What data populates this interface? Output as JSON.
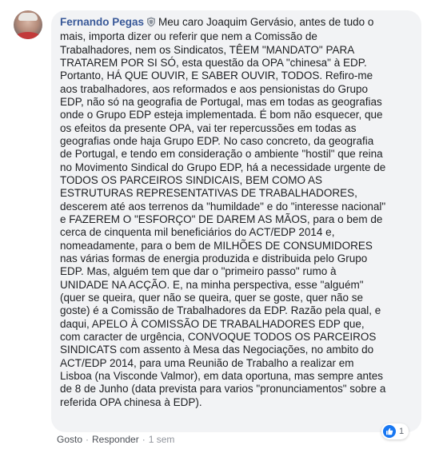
{
  "comment": {
    "author": "Fernando Pegas",
    "body": "Meu caro Joaquim Gervásio, antes de tudo o\nmais, importa dizer ou referir que nem a Comissão de\nTrabalhadores, nem os Sindicatos, TÊEM \"MANDATO\" PARA\nTRATAREM POR SI SÓ, esta questão da OPA \"chinesa\" à EDP.\nPortanto, HÁ QUE OUVIR, E SABER OUVIR, TODOS. Refiro-me\naos trabalhadores, aos reformados e aos pensionistas do Grupo\nEDP, não só na geografia de Portugal, mas em todas as geografias\nonde o Grupo EDP esteja implementada. É bom não esquecer, que\nos efeitos da presente OPA, vai ter repercussões em todas as\ngeografias onde haja Grupo EDP. No caso concreto, da geografia\nde Portugal, e tendo em consideração o ambiente \"hostil\" que reina\nno Movimento Sindical do Grupo EDP, há a necessidade urgente de\nTODOS OS PARCEIROS SINDICAIS, BEM COMO AS\nESTRUTURAS REPRESENTATIVAS DE TRABALHADORES,\ndescerem até aos terrenos da \"humildade\" e do \"interesse nacional\"\ne FAZEREM O \"ESFORÇO\" DE DAREM AS MÃOS, para o bem de\ncerca de cinquenta mil beneficiários do ACT/EDP 2014 e,\nnomeadamente, para o bem de MILHÕES DE CONSUMIDORES\nnas várias formas de energia produzida e distribuida pelo Grupo\nEDP. Mas, alguém tem que dar o \"primeiro passo\" rumo à\nUNIDADE NA ACÇÃO. E, na minha perspectiva, esse \"alguém\"\n(quer se queira, quer não se queira, quer se goste, quer não se\ngoste) é a Comissão de Trabalhadores da EDP. Razão pela qual, e\ndaqui, APELO À COMISSÃO DE TRABALHADORES EDP que,\ncom caracter de urgência, CONVOQUE TODOS OS PARCEIROS\nSINDICATS com assento à Mesa das Negociações, no ambito do\nACT/EDP 2014, para uma Reunião de Trabalho a realizar em\nLisboa (na Visconde Valmor), em data oportuna, mas sempre antes\nde 8 de Junho (data prevista para varios \"pronunciamentos\" sobre a\nreferida OPA chinesa à EDP).",
    "badge_icon": "shield-icon",
    "colors": {
      "author": "#385898",
      "bubble": "#f2f3f5",
      "like": "#1877f2"
    }
  },
  "actions": {
    "like_label": "Gosto",
    "separator": "·",
    "reply_label": "Responder",
    "time": "1 sem"
  },
  "reactions": {
    "icon": "thumbs-up-icon",
    "count": "1"
  }
}
